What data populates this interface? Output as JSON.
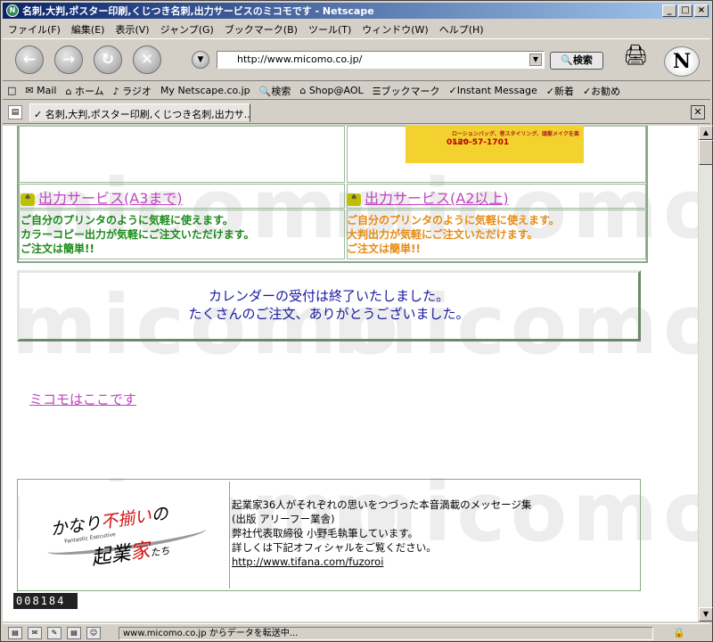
{
  "window": {
    "title": "名刺,大判,ポスター印刷,くじつき名刺,出力サービスのミコモです - Netscape",
    "btn_min": "_",
    "btn_max": "□",
    "btn_close": "×"
  },
  "menu": [
    "ファイル(F)",
    "編集(E)",
    "表示(V)",
    "ジャンプ(G)",
    "ブックマーク(B)",
    "ツール(T)",
    "ウィンドウ(W)",
    "ヘルプ(H)"
  ],
  "nav": {
    "url": "http://www.micomo.co.jp/",
    "search_label": "検索",
    "logo": "N"
  },
  "personal": [
    "Mail",
    "ホーム",
    "ラジオ",
    "Netscape.co.jp",
    "検索",
    "Shop@AOL",
    "ブックマーク",
    "Instant Message",
    "新着",
    "お勧め"
  ],
  "tab": {
    "title": "名刺,大判,ポスター印刷,くじつき名刺,出力サ..."
  },
  "page": {
    "banner_phone": "0120-57-1701",
    "banner_text": "ローションバッグ、巻スタイリング、頭髪メイクを楽しんで",
    "services": [
      {
        "title": "出力サービス(A3まで)",
        "lines": [
          "ご自分のプリンタのように気軽に使えます。",
          "カラーコピー出力が気軽にご注文いただけます。",
          "ご注文は簡単!!"
        ]
      },
      {
        "title": "出力サービス(A2以上)",
        "lines": [
          "ご自分のプリンタのように気軽に使えます。",
          "大判出力が気軽にご注文いただけます。",
          "ご注文は簡単!!"
        ]
      }
    ],
    "calendar": [
      "カレンダーの受付は終了いたしました。",
      "たくさんのご注文、ありがとうございました。"
    ],
    "map_link": "ミコモはここです",
    "book": {
      "logo_line1_a": "かなり",
      "logo_line1_b": "不揃い",
      "logo_line1_c": "の",
      "logo_line2_a": "起業",
      "logo_line2_b": "家",
      "logo_line2_c": "たち",
      "logo_small": "Fantastic Executive",
      "lines": [
        "起業家36人がそれぞれの思いをつづった本音満載のメッセージ集",
        "(出版 アリーフー業舎)",
        "弊社代表取締役 小野毛執筆しています。",
        "詳しくは下記オフィシャルをご覧ください。"
      ],
      "link": "http://www.tifana.com/fuzoroi"
    },
    "counter": "008184",
    "watermark": "micomo"
  },
  "status": {
    "text": "www.micomo.co.jp からデータを転送中..."
  }
}
